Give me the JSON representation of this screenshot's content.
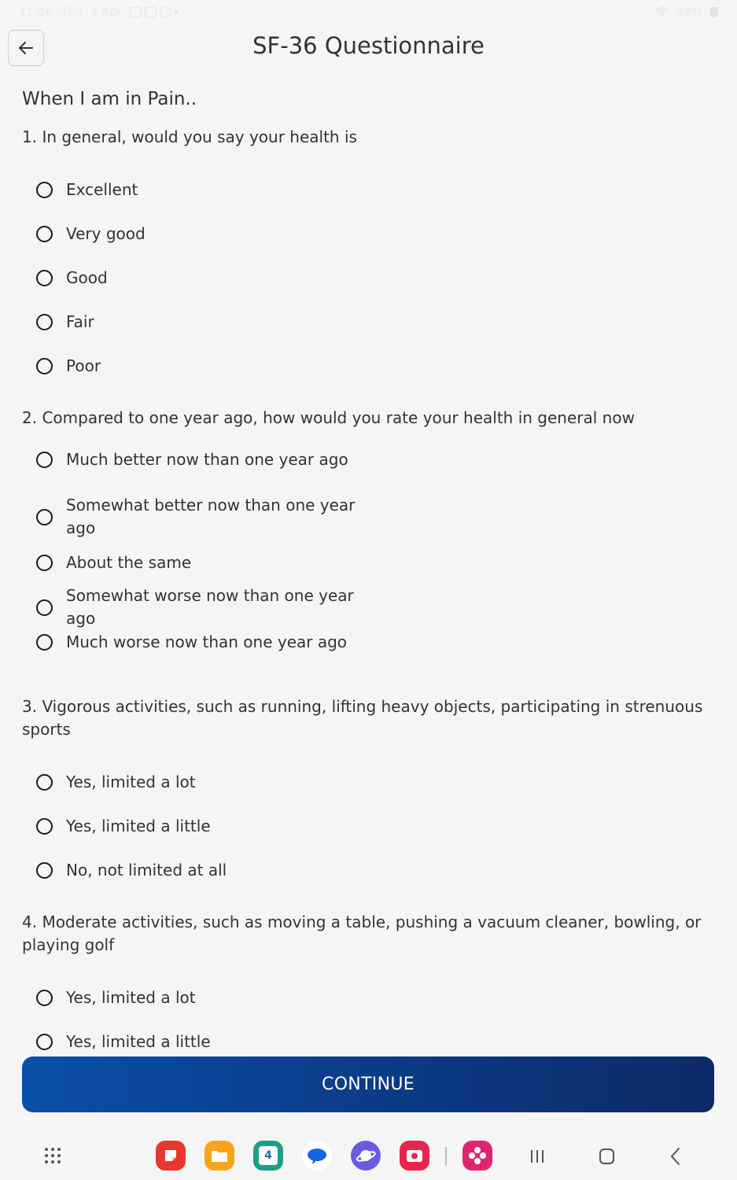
{
  "status": {
    "time": "11:56",
    "date": "Thu, 4 Apr",
    "battery": "59%"
  },
  "header": {
    "title": "SF-36 Questionnaire"
  },
  "section": {
    "title": "When I am in Pain.."
  },
  "questions": [
    {
      "text": "1. In general, would you say your health is",
      "options": [
        "Excellent",
        "Very good",
        "Good",
        "Fair",
        "Poor"
      ]
    },
    {
      "text": "2.  Compared to one year ago, how would you rate your health in general now",
      "options": [
        "Much better now than one year ago",
        "Somewhat better now than one year ago",
        "About the same",
        "Somewhat worse now than one year ago",
        "Much worse now than one year ago"
      ]
    },
    {
      "text": "3. Vigorous activities, such as running, lifting heavy objects, participating in strenuous sports",
      "options": [
        "Yes, limited a lot",
        "Yes, limited a little",
        "No, not limited at all"
      ]
    },
    {
      "text": "4. Moderate activities, such as moving a table, pushing a vacuum cleaner, bowling, or playing golf",
      "options": [
        "Yes, limited a lot",
        "Yes, limited a little"
      ]
    }
  ],
  "footer": {
    "continue_label": "CONTINUE"
  },
  "colors": {
    "primary_start": "#0a4fa9",
    "primary_end": "#0c2a66",
    "background": "#f5f5f5"
  },
  "navbar": {
    "icons": [
      "apps-grid-icon",
      "notes-app-icon",
      "files-app-icon",
      "calendar-app-icon",
      "messages-app-icon",
      "internet-app-icon",
      "screen-recorder-app-icon",
      "flower-app-icon",
      "recents-icon",
      "home-icon",
      "back-nav-icon"
    ],
    "calendar_day": "4"
  }
}
